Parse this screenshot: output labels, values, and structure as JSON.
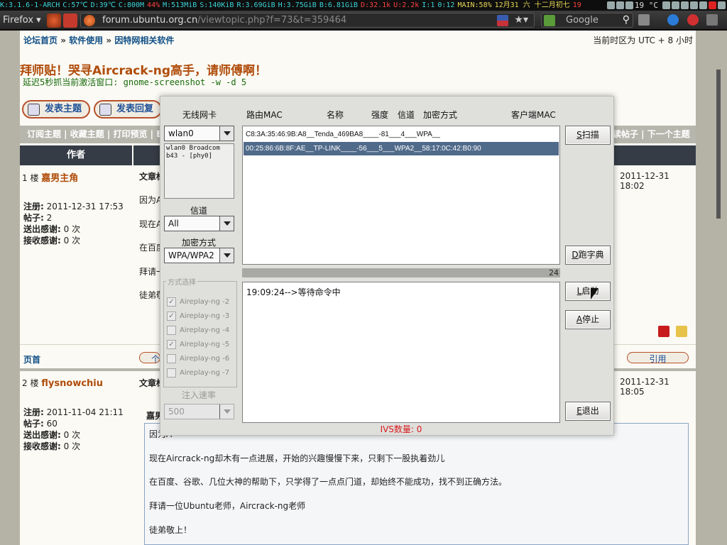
{
  "status_bar": {
    "items": [
      "K:3.1.6-1-ARCH",
      "C:57℃",
      "D:39℃",
      "C:800M",
      "44%",
      "M:513MiB",
      "S:140KiB",
      "R:3.69GiB",
      "H:3.75GiB",
      "B:6.81GiB",
      "D:32.1k",
      "U:2.2k",
      "I:1",
      "0:12",
      "MAIN:58%",
      "12月31 六 十二月初七",
      "19"
    ],
    "weather": "19 °C"
  },
  "browser": {
    "menu_label": "Firefox",
    "url_host": "forum.ubuntu.org.cn",
    "url_path": "/viewtopic.php?f=73&t=359464",
    "search_placeholder": "Google"
  },
  "forum": {
    "breadcrumb": [
      "论坛首页",
      "软件使用",
      "因特网相关软件"
    ],
    "breadcrumb_sep": "»",
    "timezone": "当前时区为 UTC + 8 小时",
    "title": "拜师贴！哭寻Aircrack-ng高手，请师傅啊！",
    "subtitle": "延迟5秒抓当前激活窗口: gnome-screenshot -w -d 5",
    "new_topic": "发表主题",
    "reply": "发表回复",
    "toolbar_left": "订阅主题 | 收藏主题 | 打印预览 | E",
    "toolbar_right": "读帖子 | 下一个主题",
    "author_header": "作者",
    "post1": {
      "floor": "1 楼",
      "author": "嘉男主角",
      "field_label": "文章标",
      "time": "2011-12-31 18:02",
      "register_label": "注册:",
      "register": "2011-12-31 17:53",
      "posts_label": "帖子:",
      "posts": "2",
      "sent_label": "送出感谢:",
      "sent": "0 次",
      "recv_label": "接收感谢:",
      "recv": "0 次",
      "body_fragments": [
        "因为A",
        "现在A",
        "在百度",
        "拜请一",
        "徒弟敬"
      ]
    },
    "home_link": "页首",
    "person_button": "个",
    "quote_button": "引用",
    "post2": {
      "floor": "2 楼",
      "author": "flysnowchiu",
      "field_label": "文章标",
      "time": "2011-12-31 18:05",
      "register_label": "注册:",
      "register": "2011-11-04 21:11",
      "posts_label": "帖子:",
      "posts": "60",
      "sent_label": "送出感谢:",
      "sent": "0 次",
      "recv_label": "接收感谢:",
      "recv": "0 次",
      "quote_author_fragment": "嘉男",
      "quote_lines": [
        "因为A",
        "现在Aircrack-ng却木有一点进展，开始的兴趣慢慢下来，只剩下一股执着劲儿",
        "在百度、谷歌、几位大神的帮助下，只学得了一点点门道，却始终不能成功，找不到正确方法。",
        "拜请一位Ubuntu老师，Aircrack-ng老师",
        "徒弟敬上！"
      ]
    }
  },
  "dialog": {
    "label_card": "无线网卡",
    "label_router": "路由MAC",
    "label_name": "名称",
    "label_strength": "强度",
    "label_channel": "信道",
    "label_enc": "加密方式",
    "label_client": "客户端MAC",
    "card_value": "wlan0",
    "card_desc": "wlan0 Broadcom b43 - [phy0]",
    "channel_label": "信道",
    "channel_value": "All",
    "enc_label": "加密方式",
    "enc_value": "WPA/WPA2",
    "method_legend": "方式选择",
    "methods": [
      {
        "label": "Aireplay-ng -2",
        "checked": true
      },
      {
        "label": "Aireplay-ng -3",
        "checked": true
      },
      {
        "label": "Aireplay-ng -4",
        "checked": false
      },
      {
        "label": "Aireplay-ng -5",
        "checked": true
      },
      {
        "label": "Aireplay-ng -6",
        "checked": false
      },
      {
        "label": "Aireplay-ng -7",
        "checked": false
      }
    ],
    "inject_label": "注入速率",
    "inject_value": "500",
    "ap_rows": [
      "C8:3A:35:46:9B:A8__Tenda_469BA8____-81___4___WPA__",
      "00:25:86:6B:8F:AE__TP-LINK____-56___5___WPA2__58:17:0C:42:B0:90"
    ],
    "count": "24",
    "log": "19:09:24-->等待命令中",
    "ivs": "IVS数量: 0",
    "buttons": {
      "scan": {
        "key": "S",
        "label": "扫描"
      },
      "dict": {
        "key": "D",
        "label": "跑字典"
      },
      "start": {
        "key": "L",
        "label": "启动"
      },
      "stop": {
        "key": "A",
        "label": "停止"
      },
      "exit": {
        "key": "E",
        "label": "退出"
      }
    }
  },
  "colors": {
    "accent": "#b04c0a",
    "link": "#104f86",
    "selected_row": "#506a8a",
    "ivs_text": "#d81c1c"
  }
}
